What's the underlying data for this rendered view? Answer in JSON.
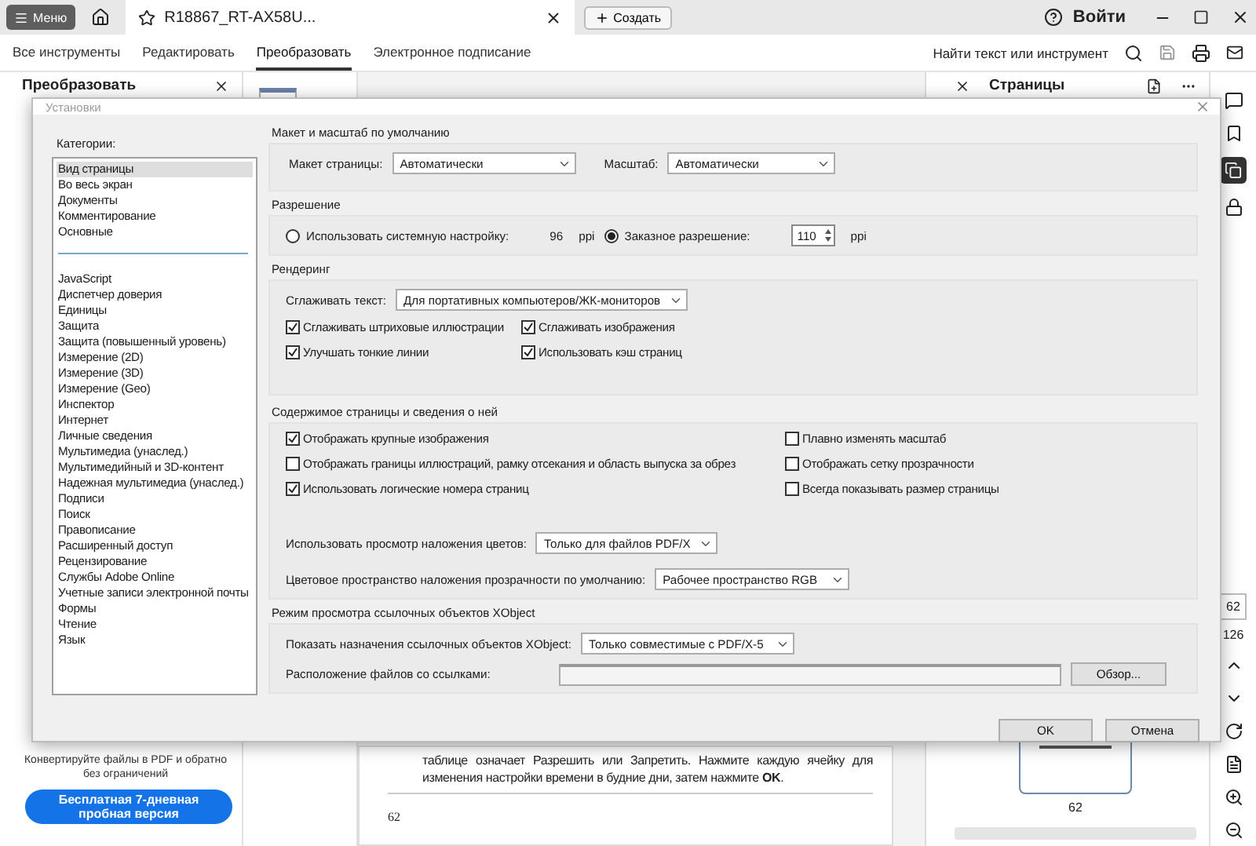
{
  "titlebar": {
    "menu": "Меню",
    "tab_title": "R18867_RT-AX58U...",
    "new_button": "Создать",
    "sign_in": "Войти"
  },
  "toolbar": {
    "tabs": [
      {
        "label": "Все инструменты",
        "selected": false
      },
      {
        "label": "Редактировать",
        "selected": false
      },
      {
        "label": "Преобразовать",
        "selected": true
      },
      {
        "label": "Электронное подписание",
        "selected": false
      }
    ],
    "search_label": "Найти текст или инструмент"
  },
  "left_panel": {
    "title": "Преобразовать",
    "promo": "Конвертируйте файлы в PDF и обратно без ограничений",
    "trial_button": "Бесплатная 7-дневная пробная версия"
  },
  "document": {
    "text": "таблице означает Разрешить или Запретить. Нажмите каждую ячейку для изменения настройки времени в будние дни, затем нажмите **OK**.",
    "page_number": "62"
  },
  "pages_panel": {
    "title": "Страницы",
    "thumbnail_label": "62"
  },
  "page_nav": {
    "current": "62",
    "total": "126"
  },
  "dialog": {
    "title": "Установки",
    "categories_label": "Категории:",
    "category_groups": [
      {
        "items": [
          {
            "label": "Вид страницы",
            "selected": true
          },
          {
            "label": "Во весь экран",
            "selected": false
          },
          {
            "label": "Документы",
            "selected": false
          },
          {
            "label": "Комментирование",
            "selected": false
          },
          {
            "label": "Основные",
            "selected": false
          }
        ]
      },
      {
        "items": [
          {
            "label": "JavaScript",
            "selected": false
          },
          {
            "label": "Диспетчер доверия",
            "selected": false
          },
          {
            "label": "Единицы",
            "selected": false
          },
          {
            "label": "Защита",
            "selected": false
          },
          {
            "label": "Защита (повышенный уровень)",
            "selected": false
          },
          {
            "label": "Измерение (2D)",
            "selected": false
          },
          {
            "label": "Измерение (3D)",
            "selected": false
          },
          {
            "label": "Измерение (Geo)",
            "selected": false
          },
          {
            "label": "Инспектор",
            "selected": false
          },
          {
            "label": "Интернет",
            "selected": false
          },
          {
            "label": "Личные сведения",
            "selected": false
          },
          {
            "label": "Мультимедиа (унаслед.)",
            "selected": false
          },
          {
            "label": "Мультимедийный и 3D-контент",
            "selected": false
          },
          {
            "label": "Надежная мультимедиа (унаслед.)",
            "selected": false
          },
          {
            "label": "Подписи",
            "selected": false
          },
          {
            "label": "Поиск",
            "selected": false
          },
          {
            "label": "Правописание",
            "selected": false
          },
          {
            "label": "Расширенный доступ",
            "selected": false
          },
          {
            "label": "Рецензирование",
            "selected": false
          },
          {
            "label": "Службы Adobe Online",
            "selected": false
          },
          {
            "label": "Учетные записи электронной почты",
            "selected": false
          },
          {
            "label": "Формы",
            "selected": false
          },
          {
            "label": "Чтение",
            "selected": false
          },
          {
            "label": "Язык",
            "selected": false
          }
        ]
      }
    ],
    "layout_section": {
      "title": "Макет и масштаб по умолчанию",
      "page_layout_label": "Макет страницы:",
      "page_layout": "Автоматически",
      "zoom_label": "Масштаб:",
      "zoom": "Автоматически"
    },
    "resolution_section": {
      "title": "Разрешение",
      "options": [
        {
          "kind": "fixed",
          "label": "Использовать системную настройку:",
          "selected": false,
          "value": "96",
          "unit": "ppi"
        },
        {
          "kind": "spinner",
          "label": "Заказное разрешение:",
          "selected": true,
          "value": "110",
          "unit": "ppi"
        }
      ]
    },
    "rendering_section": {
      "title": "Рендеринг",
      "smooth_text_label": "Сглаживать текст:",
      "smooth_text": "Для портативных компьютеров/ЖК-мониторов",
      "checkboxes": [
        {
          "label": "Сглаживать штриховые иллюстрации",
          "checked": true
        },
        {
          "label": "Сглаживать изображения",
          "checked": true
        },
        {
          "label": "Улучшать тонкие линии",
          "checked": true
        },
        {
          "label": "Использовать кэш страниц",
          "checked": true
        }
      ]
    },
    "content_section": {
      "title": "Содержимое страницы и сведения о ней",
      "checkboxes": [
        {
          "label": "Отображать крупные изображения",
          "checked": true
        },
        {
          "label": "Плавно изменять масштаб",
          "checked": false
        },
        {
          "label": "Отображать границы иллюстраций, рамку отсекания и область выпуска за обрез",
          "checked": false
        },
        {
          "label": "Отображать сетку прозрачности",
          "checked": false
        },
        {
          "label": "Использовать логические номера страниц",
          "checked": true
        },
        {
          "label": "Всегда показывать размер страницы",
          "checked": false
        }
      ],
      "selects": [
        {
          "label": "Использовать просмотр наложения цветов:",
          "value": "Только для файлов PDF/X"
        },
        {
          "label": "Цветовое пространство наложения прозрачности по умолчанию:",
          "value": "Рабочее пространство RGB"
        }
      ]
    },
    "xobject_section": {
      "title": "Режим просмотра ссылочных объектов XObject",
      "show_label": "Показать назначения ссылочных объектов XObject:",
      "show_value": "Только совместимые с PDF/X-5",
      "location_label": "Расположение файлов со ссылками:",
      "browse_button": "Обзор..."
    },
    "buttons": [
      "OK",
      "Отмена"
    ]
  }
}
